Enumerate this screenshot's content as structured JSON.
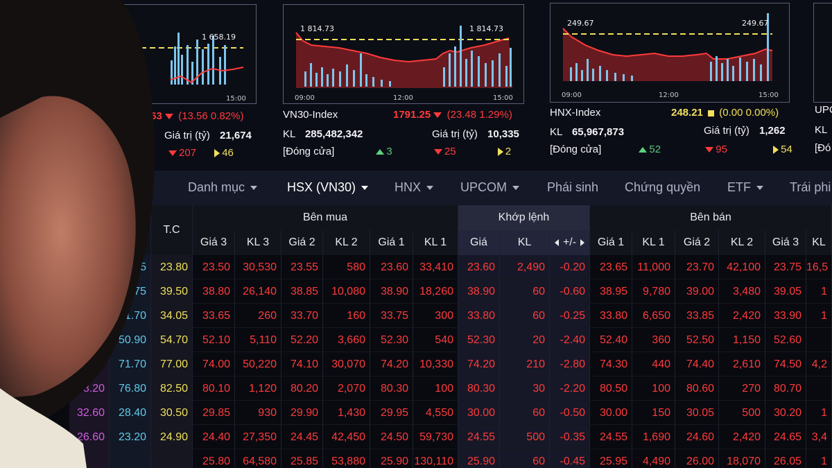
{
  "colors": {
    "down": "#ff3b3b",
    "ref": "#f1e05a",
    "up": "#5bd37a",
    "ceiling": "#d05ee0",
    "floor": "#63c8e8",
    "bar": "#7cc6ee"
  },
  "panels": [
    {
      "id": "vnindex",
      "peak": "1 658.19",
      "time_end": "15:00",
      "value_partial": ".63",
      "change": "(13.56",
      "pct": "0.82%)",
      "gtr_label": "Giá trị (tỷ)",
      "gtr_value": "21,674",
      "down": "207",
      "ref": "46"
    },
    {
      "id": "vn30",
      "name": "VN30-Index",
      "value": "1791.25",
      "change": "(23.48",
      "pct": "1.29%)",
      "peak_left": "1 814.73",
      "peak_right": "1 814.73",
      "times": [
        "09:00",
        "12:00",
        "15:00"
      ],
      "kl_label": "KL",
      "kl_value": "285,482,342",
      "gtr_label": "Giá trị (tỷ)",
      "gtr_value": "10,335",
      "status": "[Đóng cửa]",
      "up": "3",
      "down": "25",
      "ref": "2"
    },
    {
      "id": "hnx",
      "name": "HNX-Index",
      "value": "248.21",
      "change": "(0.00",
      "pct": "0.00%)",
      "peak_left": "249.67",
      "peak_right": "249.67",
      "times": [
        "09:00",
        "12:00",
        "15:00"
      ],
      "kl_label": "KL",
      "kl_value": "65,967,873",
      "gtr_label": "Giá trị (tỷ)",
      "gtr_value": "1,262",
      "status": "[Đóng cửa]",
      "up": "52",
      "down": "95",
      "ref": "54"
    },
    {
      "id": "upcom",
      "name": "UPC",
      "kl_label": "KL",
      "status": "[Đó"
    }
  ],
  "tabs": [
    "Danh mục",
    "HSX (VN30)",
    "HNX",
    "UPCOM",
    "Phái sinh",
    "Chứng quyền",
    "ETF",
    "Trái phi"
  ],
  "table": {
    "groups": {
      "buy": "Bên mua",
      "match": "Khớp lệnh",
      "sell": "Bên bán"
    },
    "headers": {
      "partial": "n",
      "ref": "T.C",
      "buy": [
        "Giá 3",
        "KL 3",
        "Giá 2",
        "KL 2",
        "Giá 1",
        "KL 1"
      ],
      "match": [
        "Giá",
        "KL",
        "+/-"
      ],
      "sell": [
        "Giá 1",
        "KL 1",
        "Giá 2",
        "KL 2",
        "Giá 3",
        "KL"
      ]
    },
    "rows": [
      {
        "ceil": "",
        "floor": "2.15",
        "ref": "23.80",
        "buy": [
          "23.50",
          "30,530",
          "23.55",
          "580",
          "23.60",
          "33,410"
        ],
        "match": [
          "23.60",
          "2,490",
          "-0.20"
        ],
        "sell": [
          "23.65",
          "11,000",
          "23.70",
          "42,100",
          "23.75",
          "16,5"
        ]
      },
      {
        "ceil": "",
        "floor": "36.75",
        "ref": "39.50",
        "buy": [
          "38.80",
          "26,140",
          "38.85",
          "10,080",
          "38.90",
          "18,260"
        ],
        "match": [
          "38.90",
          "60",
          "-0.60"
        ],
        "sell": [
          "38.95",
          "9,780",
          "39.00",
          "3,480",
          "39.05",
          "1"
        ]
      },
      {
        "ceil": "",
        "floor": "31.70",
        "ref": "34.05",
        "buy": [
          "33.65",
          "260",
          "33.70",
          "160",
          "33.75",
          "300"
        ],
        "match": [
          "33.80",
          "60",
          "-0.25"
        ],
        "sell": [
          "33.80",
          "6,650",
          "33.85",
          "2,420",
          "33.90",
          "1"
        ]
      },
      {
        "ceil": ".50",
        "floor": "50.90",
        "ref": "54.70",
        "buy": [
          "52.10",
          "5,110",
          "52.20",
          "3,660",
          "52.30",
          "540"
        ],
        "match": [
          "52.30",
          "20",
          "-2.40"
        ],
        "sell": [
          "52.40",
          "360",
          "52.50",
          "1,150",
          "52.60",
          ""
        ]
      },
      {
        "ceil": "82.30",
        "floor": "71.70",
        "ref": "77.00",
        "buy": [
          "74.00",
          "50,220",
          "74.10",
          "30,070",
          "74.20",
          "10,330"
        ],
        "match": [
          "74.20",
          "210",
          "-2.80"
        ],
        "sell": [
          "74.30",
          "440",
          "74.40",
          "2,610",
          "74.50",
          "4,2"
        ]
      },
      {
        "ceil": "88.20",
        "floor": "76.80",
        "ref": "82.50",
        "buy": [
          "80.10",
          "1,120",
          "80.20",
          "2,070",
          "80.30",
          "100"
        ],
        "match": [
          "80.30",
          "30",
          "-2.20"
        ],
        "sell": [
          "80.50",
          "100",
          "80.60",
          "270",
          "80.70",
          ""
        ]
      },
      {
        "ceil": "32.60",
        "floor": "28.40",
        "ref": "30.50",
        "buy": [
          "29.85",
          "930",
          "29.90",
          "1,430",
          "29.95",
          "4,550"
        ],
        "match": [
          "30.00",
          "60",
          "-0.50"
        ],
        "sell": [
          "30.00",
          "150",
          "30.05",
          "500",
          "30.20",
          "1"
        ]
      },
      {
        "ceil": "26.60",
        "floor": "23.20",
        "ref": "24.90",
        "buy": [
          "24.40",
          "27,350",
          "24.45",
          "42,450",
          "24.50",
          "59,730"
        ],
        "match": [
          "24.55",
          "500",
          "-0.35"
        ],
        "sell": [
          "24.55",
          "1,690",
          "24.60",
          "2,420",
          "24.65",
          "3,4"
        ]
      },
      {
        "ceil": "",
        "floor": "",
        "ref": "",
        "buy": [
          "25.80",
          "64,580",
          "25.85",
          "53,880",
          "25.90",
          "130,110"
        ],
        "match": [
          "25.90",
          "60",
          "-0.45"
        ],
        "sell": [
          "25.95",
          "4,490",
          "26.00",
          "18,070",
          "26.05",
          "1"
        ]
      }
    ],
    "row_label_partial": "AS"
  }
}
